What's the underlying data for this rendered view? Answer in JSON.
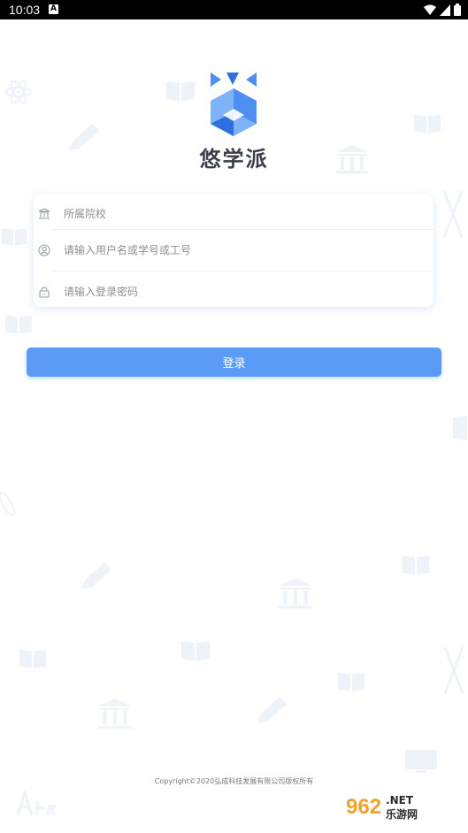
{
  "status_bar": {
    "time": "10:03",
    "notification_glyph": "A",
    "icons": [
      "wifi-icon",
      "signal-icon",
      "battery-icon"
    ]
  },
  "app": {
    "name": "悠学派",
    "logo_colors": [
      "#4f8ff2",
      "#7fb3f8",
      "#2f6fde"
    ]
  },
  "form": {
    "school": {
      "icon": "school-building-icon",
      "value": "",
      "placeholder": "所属院校"
    },
    "username": {
      "icon": "user-icon",
      "value": "",
      "placeholder": "请输入用户名或学号或工号"
    },
    "password": {
      "icon": "lock-icon",
      "value": "",
      "placeholder": "请输入登录密码"
    }
  },
  "login_button": {
    "label": "登录",
    "color": "#5b9af5"
  },
  "footer": {
    "copyright": "Copyright©2020弘成科技发展有限公司版权所有"
  },
  "watermark": {
    "number": "962",
    "suffix": ".NET",
    "subtitle": "乐游网"
  }
}
